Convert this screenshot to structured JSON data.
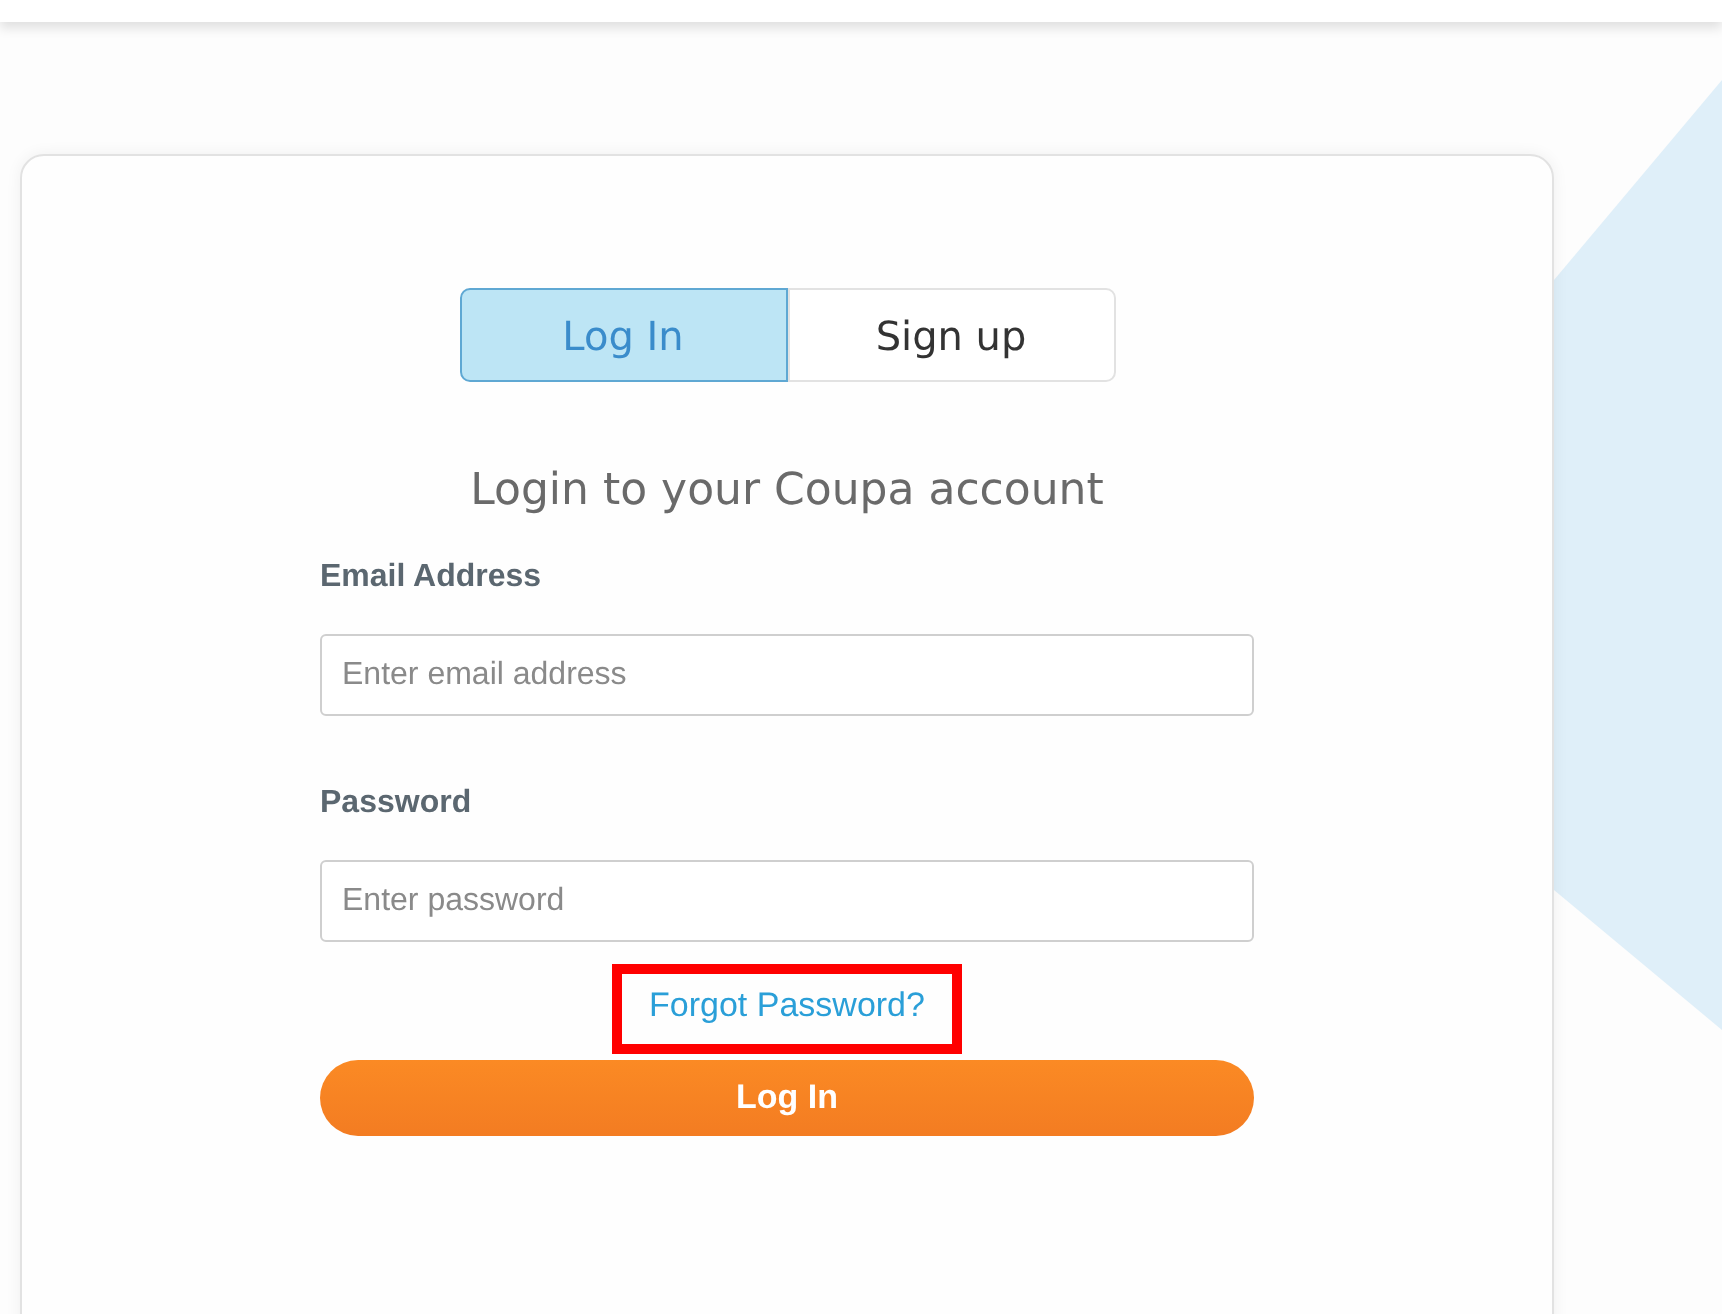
{
  "tabs": [
    {
      "label": "Log In",
      "selected": true
    },
    {
      "label": "Sign up",
      "selected": false
    }
  ],
  "heading": "Login to your Coupa account",
  "fields": [
    {
      "label": "Email Address",
      "placeholder": "Enter email address"
    },
    {
      "label": "Password",
      "placeholder": "Enter password"
    }
  ],
  "forgot_link": {
    "text": "Forgot Password?",
    "highlighted": true
  },
  "submit_button": "Log In"
}
